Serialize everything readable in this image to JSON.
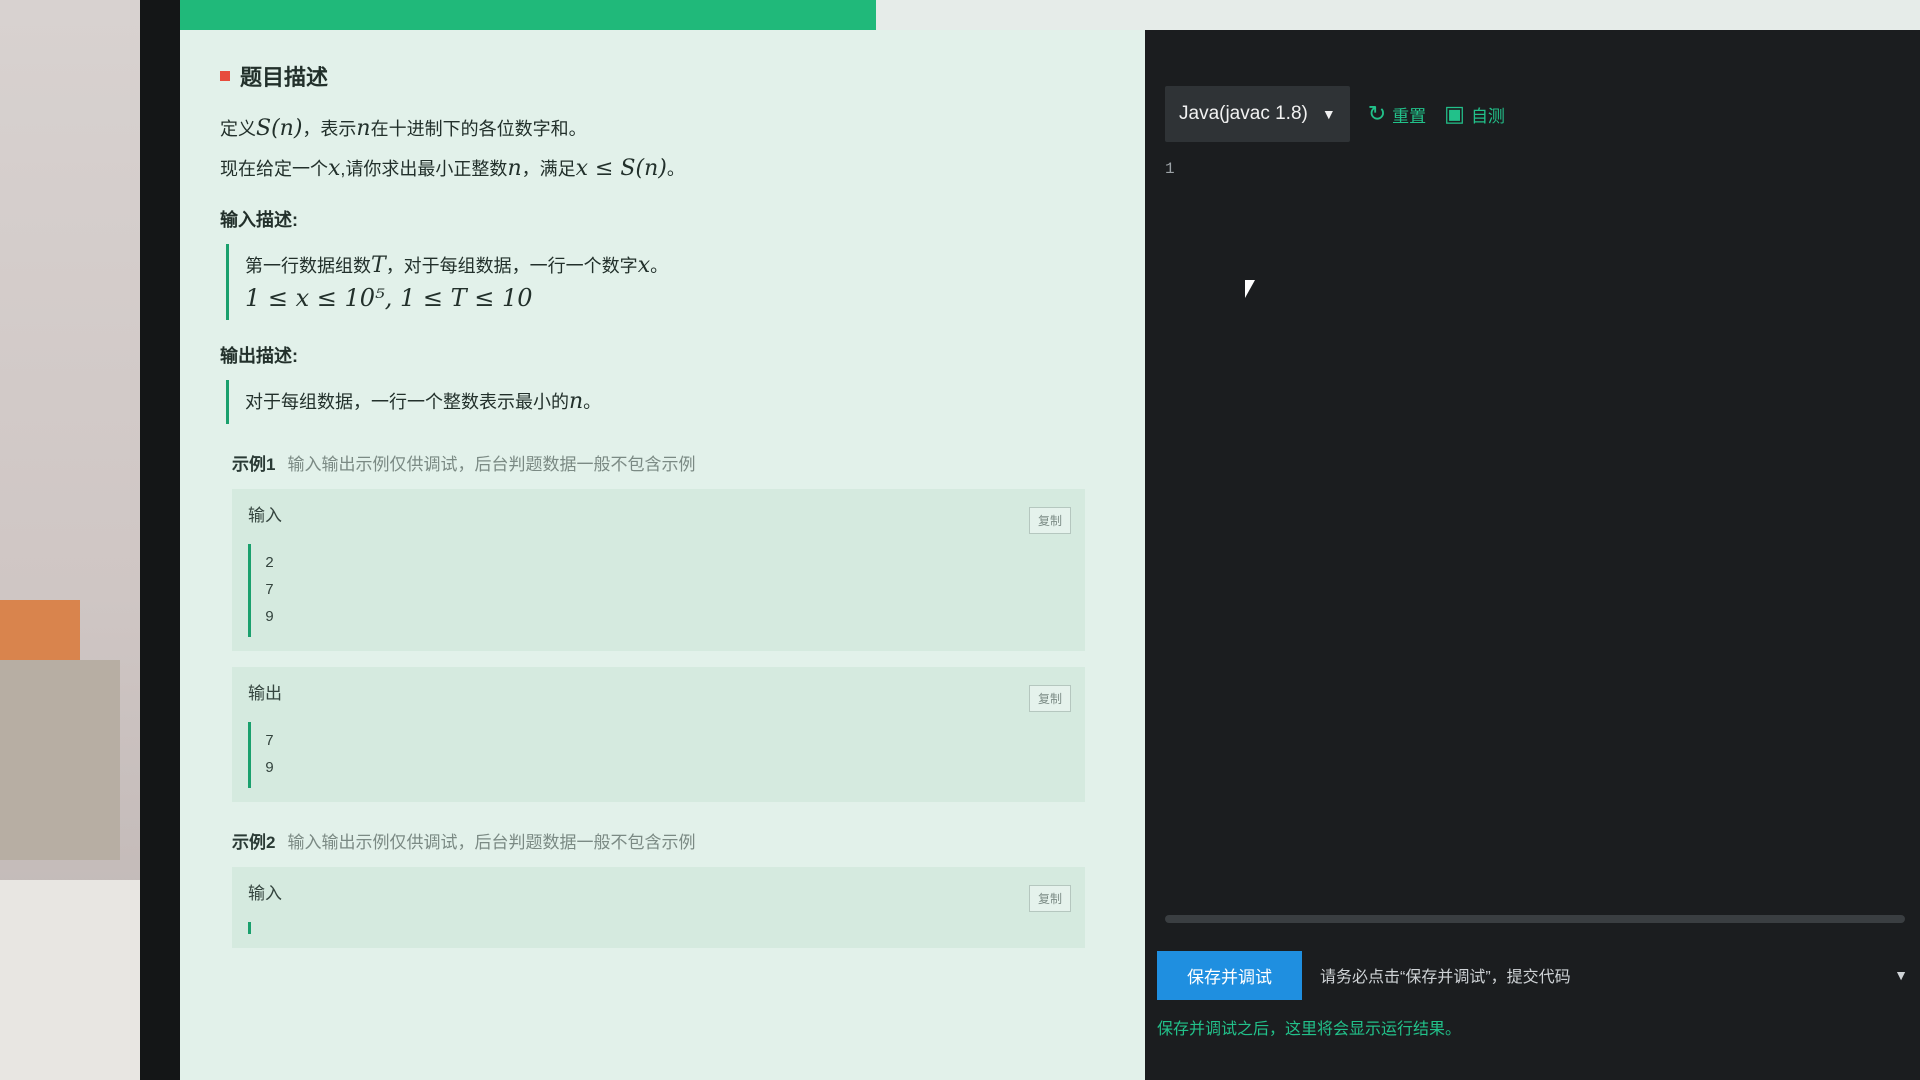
{
  "progress": {
    "value_percent": 40,
    "fill_color": "#20b97a"
  },
  "problem": {
    "section_title": "题目描述",
    "desc_line1_a": "定义",
    "desc_line1_math1": "S(n)",
    "desc_line1_b": "，表示",
    "desc_line1_math2": "n",
    "desc_line1_c": "在十进制下的各位数字和。",
    "desc_line2_a": "现在给定一个",
    "desc_line2_math1": "x",
    "desc_line2_b": ",请你求出最小正整数",
    "desc_line2_math2": "n",
    "desc_line2_c": "，满足",
    "desc_line2_math3": "x ≤ S(n)",
    "desc_line2_d": "。",
    "input_heading": "输入描述:",
    "input_desc_a": "第一行数据组数",
    "input_desc_math1": "T",
    "input_desc_b": "，对于每组数据，一行一个数字",
    "input_desc_math2": "x",
    "input_desc_c": "。",
    "input_constraints": "1 ≤ x ≤ 10⁵, 1 ≤ T ≤ 10",
    "output_heading": "输出描述:",
    "output_desc_a": "对于每组数据，一行一个整数表示最小的",
    "output_desc_math": "n",
    "output_desc_b": "。",
    "example1": {
      "title": "示例1",
      "note": "输入输出示例仅供调试，后台判题数据一般不包含示例",
      "input_label": "输入",
      "input_lines": [
        "2",
        "7",
        "9"
      ],
      "output_label": "输出",
      "output_lines": [
        "7",
        "9"
      ],
      "copy_label": "复制"
    },
    "example2": {
      "title": "示例2",
      "note": "输入输出示例仅供调试，后台判题数据一般不包含示例",
      "input_label": "输入",
      "copy_label": "复制"
    }
  },
  "editor": {
    "language": "Java(javac 1.8)",
    "reset_label": "重置",
    "selftest_label": "自测",
    "line_number": "1",
    "run_button": "保存并调试",
    "hint": "请务必点击“保存并调试”，提交代码",
    "result_hint": "保存并调试之后，这里将会显示运行结果。"
  },
  "icons": {
    "reset": "refresh-icon",
    "selftest": "monitor-icon",
    "chevron": "chevron-down-icon"
  },
  "colors": {
    "accent": "#20b97a",
    "button_blue": "#1f8fe0",
    "panel_bg": "#e2f1ea",
    "editor_bg": "#1b1d1f"
  }
}
